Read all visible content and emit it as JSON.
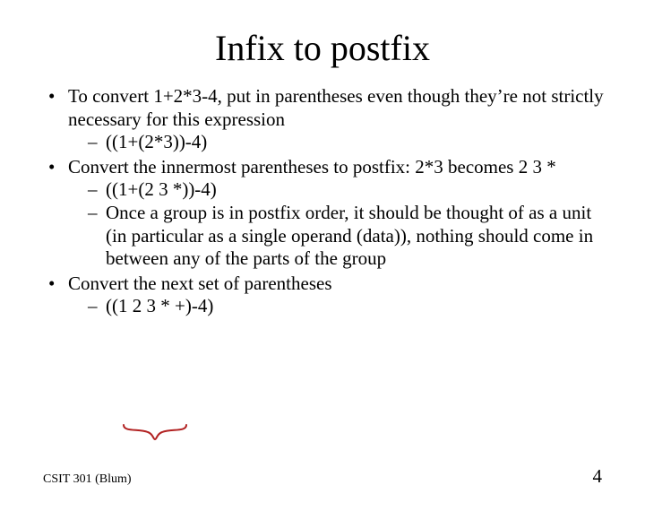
{
  "title": "Infix to postfix",
  "bullets": {
    "b1": "To convert 1+2*3-4, put in parentheses even though they’re not strictly necessary for this expression",
    "b1s1": "((1+(2*3))-4)",
    "b2": "Convert the innermost parentheses to postfix:  2*3 becomes 2 3 *",
    "b2s1": "((1+(2 3 *))-4)",
    "b2s2": "Once a group is in postfix order, it should be thought of as a unit (in particular as a single operand (data)), nothing should come in between any of the parts of the group",
    "b3": "Convert the next set of parentheses",
    "b3s1": "((1 2 3 * +)-4)"
  },
  "footer": {
    "left": "CSIT 301 (Blum)",
    "page": "4"
  }
}
